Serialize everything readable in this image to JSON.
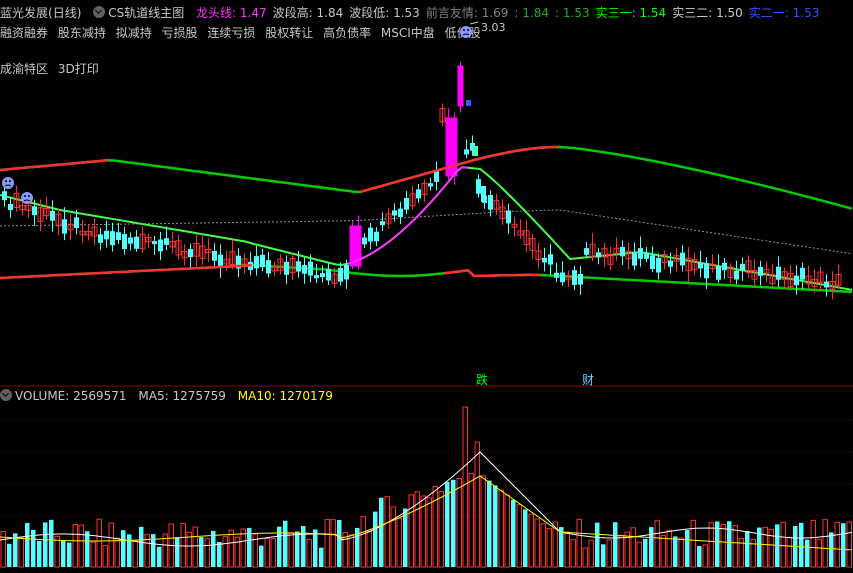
{
  "header": {
    "stock_name": "蓝光发展",
    "period": "(日线)",
    "indicator_name": "CS轨道线主图",
    "fields": [
      {
        "label": "龙头线:",
        "value": "1.47",
        "label_color": "#ff30ff",
        "value_color": "#ff30ff"
      },
      {
        "label": "波段高:",
        "value": "1.84",
        "label_color": "#c8c8c8",
        "value_color": "#c8c8c8"
      },
      {
        "label": "波段低:",
        "value": "1.53",
        "label_color": "#c8c8c8",
        "value_color": "#c8c8c8"
      },
      {
        "label": "前言友情:",
        "value": "1.69",
        "label_color": "#808080",
        "value_color": "#808080"
      },
      {
        "label": ":",
        "value": "1.84",
        "label_color": "#808080",
        "value_color": "#22aa22"
      },
      {
        "label": ":",
        "value": "1.53",
        "label_color": "#808080",
        "value_color": "#22aa22"
      },
      {
        "label": "实三一:",
        "value": "1.54",
        "label_color": "#00ff00",
        "value_color": "#00ff00"
      },
      {
        "label": "实三二:",
        "value": "1.50",
        "label_color": "#c8c8c8",
        "value_color": "#c8c8c8"
      },
      {
        "label": "实二一:",
        "value": "1.53",
        "label_color": "#3050ff",
        "value_color": "#3050ff"
      }
    ]
  },
  "concepts": [
    "融资融券",
    "股东减持",
    "拟减持",
    "亏损股",
    "连续亏损",
    "股权转让",
    "高负债率",
    "MSCI中盘",
    "低价股"
  ],
  "sector": [
    "成渝特区",
    "3D打印"
  ],
  "peak_label": "3.03",
  "event_markers": [
    {
      "text": "跌",
      "color": "#00ff00"
    },
    {
      "text": "财",
      "color": "#66ccff"
    }
  ],
  "volume": {
    "label": "VOLUME:",
    "value": "2569571",
    "ma5_label": "MA5:",
    "ma5_value": "1275759",
    "ma10_label": "MA10:",
    "ma10_value": "1270179"
  },
  "colors": {
    "up": "#ff3030",
    "down": "#54ffff",
    "limit_up": "#ff00ff",
    "outer_track": "#00cc00",
    "inner_track": "#44ff44",
    "leader_line": "#ff30ff",
    "ma5_vol": "#ffffff",
    "ma10_vol": "#ffff00"
  }
}
